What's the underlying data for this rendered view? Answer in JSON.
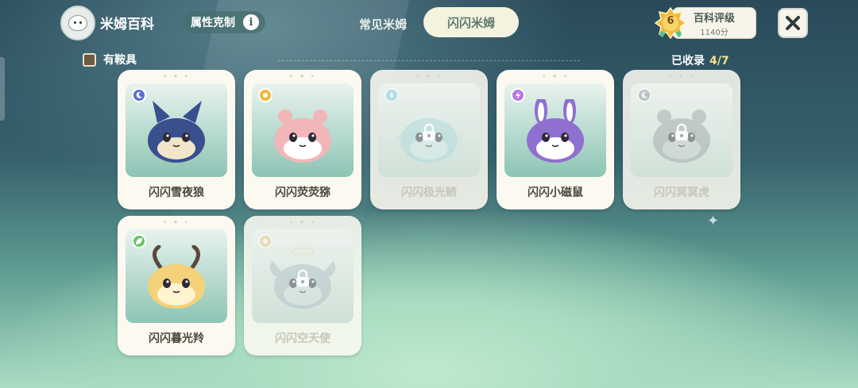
{
  "header": {
    "title": "米姆百科",
    "attr_label": "属性克制",
    "info_glyph": "i",
    "tabs": [
      {
        "label": "常见米姆",
        "active": false
      },
      {
        "label": "闪闪米姆",
        "active": true
      }
    ],
    "rating": {
      "level": "6",
      "title": "百科评级",
      "score": "1140分"
    }
  },
  "filter": {
    "label": "有鞍具",
    "checked": false
  },
  "collected": {
    "label": "已收录",
    "count": "4/7"
  },
  "cards": [
    {
      "name": "闪闪雪夜狼",
      "element": "moon-icon",
      "element_color": "#5b6fd0",
      "locked": false,
      "body": "#3a4f8e",
      "accent": "#f1e6c9",
      "ears": "fox"
    },
    {
      "name": "闪闪荧荧猕",
      "element": "sun-icon",
      "element_color": "#f3b73f",
      "locked": false,
      "body": "#f1b7b8",
      "accent": "#ffffff",
      "ears": "round"
    },
    {
      "name": "闪闪极光鲼",
      "element": "water-icon",
      "element_color": "#6ec3e6",
      "locked": true,
      "body": "#a9d8dd",
      "accent": "#d8eeee",
      "ears": "ray"
    },
    {
      "name": "闪闪小磁鼠",
      "element": "lightning-icon",
      "element_color": "#b67ae0",
      "locked": false,
      "body": "#8f6fd0",
      "accent": "#ffffff",
      "ears": "bunny"
    },
    {
      "name": "闪闪冥冥虎",
      "element": "moon-icon",
      "element_color": "#7f8fa0",
      "locked": true,
      "body": "#9aa2a6",
      "accent": "#c7cccc",
      "ears": "round"
    },
    {
      "name": "闪闪暮光羚",
      "element": "leaf-icon",
      "element_color": "#6cc36b",
      "locked": false,
      "body": "#f3d27a",
      "accent": "#fff4d0",
      "ears": "antler"
    },
    {
      "name": "闪闪空天使",
      "element": "sun-icon",
      "element_color": "#e3c37a",
      "locked": true,
      "body": "#a9bcc3",
      "accent": "#d6e1e3",
      "ears": "wing"
    }
  ]
}
